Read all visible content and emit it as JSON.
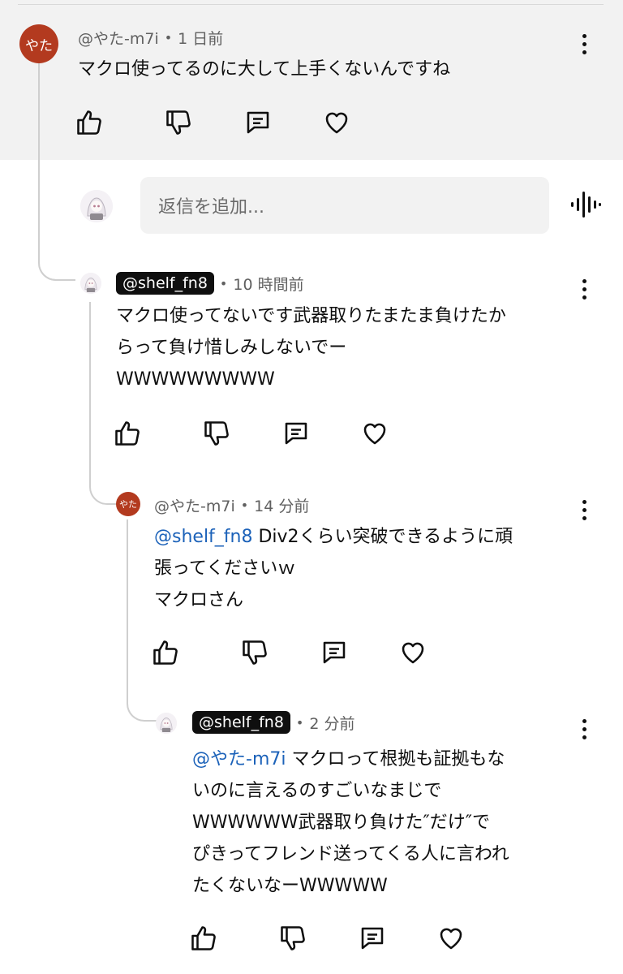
{
  "top_comment": {
    "avatar_text": "やた",
    "author": "@やた-m7i",
    "time": "1 日前",
    "text_lines": [
      "マクロ使ってるのに大して上手くないんですね"
    ]
  },
  "reply_box": {
    "placeholder": "返信を追加..."
  },
  "replies": [
    {
      "author": "@shelf_fn8",
      "time": "10 時間前",
      "text_lines": [
        "マクロ使ってないです武器取りたまたま負けたか",
        "らって負け惜しみしないでー",
        "WWWWWWWWW"
      ]
    },
    {
      "avatar_text": "やた",
      "author": "@やた-m7i",
      "time": "14 分前",
      "mention": "@shelf_fn8",
      "text_lines": [
        " Div2くらい突破できるように頑",
        "張ってくださいｗ",
        "マクロさん"
      ]
    },
    {
      "author": "@shelf_fn8",
      "time": "2 分前",
      "mention": "@やた-m7i",
      "text_lines": [
        " マクロって根拠も証拠もな",
        "いのに言えるのすごいなまじで",
        "WWWWWW武器取り負けた″だけ″で",
        "ぴきってフレンド送ってくる人に言われ",
        "たくないなーWWWWW"
      ]
    }
  ],
  "icons": [
    "like-icon",
    "dislike-icon",
    "reply-icon",
    "heart-icon",
    "more-vert-icon",
    "voice-search-icon"
  ],
  "colors": {
    "mention": "#1c62b9",
    "avatar_bg": "#b33a1f",
    "band_bg": "#f2f2f2"
  }
}
